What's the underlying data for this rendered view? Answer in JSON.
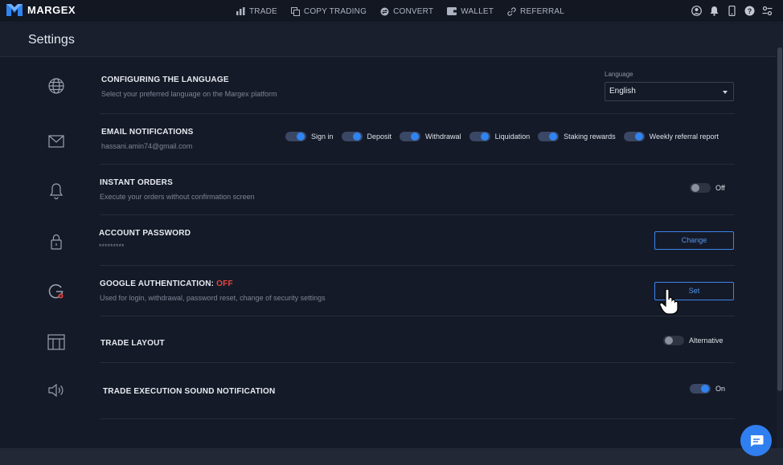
{
  "brand": {
    "name": "MARGEX",
    "accent": "#2f84f0"
  },
  "nav": [
    {
      "label": "TRADE",
      "icon": "bar-chart-icon"
    },
    {
      "label": "COPY TRADING",
      "icon": "copy-icon"
    },
    {
      "label": "CONVERT",
      "icon": "convert-icon"
    },
    {
      "label": "WALLET",
      "icon": "wallet-icon"
    },
    {
      "label": "REFERRAL",
      "icon": "link-icon"
    }
  ],
  "page": {
    "title": "Settings"
  },
  "language": {
    "title": "CONFIGURING THE LANGUAGE",
    "subtitle": "Select your preferred language on the Margex platform",
    "field_label": "Language",
    "selected": "English"
  },
  "email": {
    "title": "EMAIL NOTIFICATIONS",
    "address": "hassani.amin74@gmail.com",
    "toggles": [
      {
        "label": "Sign in",
        "on": true
      },
      {
        "label": "Deposit",
        "on": true
      },
      {
        "label": "Withdrawal",
        "on": true
      },
      {
        "label": "Liquidation",
        "on": true
      },
      {
        "label": "Staking rewards",
        "on": true
      },
      {
        "label": "Weekly referral report",
        "on": true
      }
    ]
  },
  "instant_orders": {
    "title": "INSTANT ORDERS",
    "subtitle": "Execute your orders without confirmation screen",
    "state_label": "Off"
  },
  "password": {
    "title": "ACCOUNT PASSWORD",
    "masked": "*********",
    "button": "Change"
  },
  "google_auth": {
    "title": "GOOGLE AUTHENTICATION: ",
    "status": "OFF",
    "subtitle": "Used for login, withdrawal, password reset, change of security settings",
    "button": "Set"
  },
  "trade_layout": {
    "title": "TRADE LAYOUT",
    "state_label": "Alternative"
  },
  "sound": {
    "title": "TRADE EXECUTION SOUND NOTIFICATION",
    "state_label": "On"
  }
}
